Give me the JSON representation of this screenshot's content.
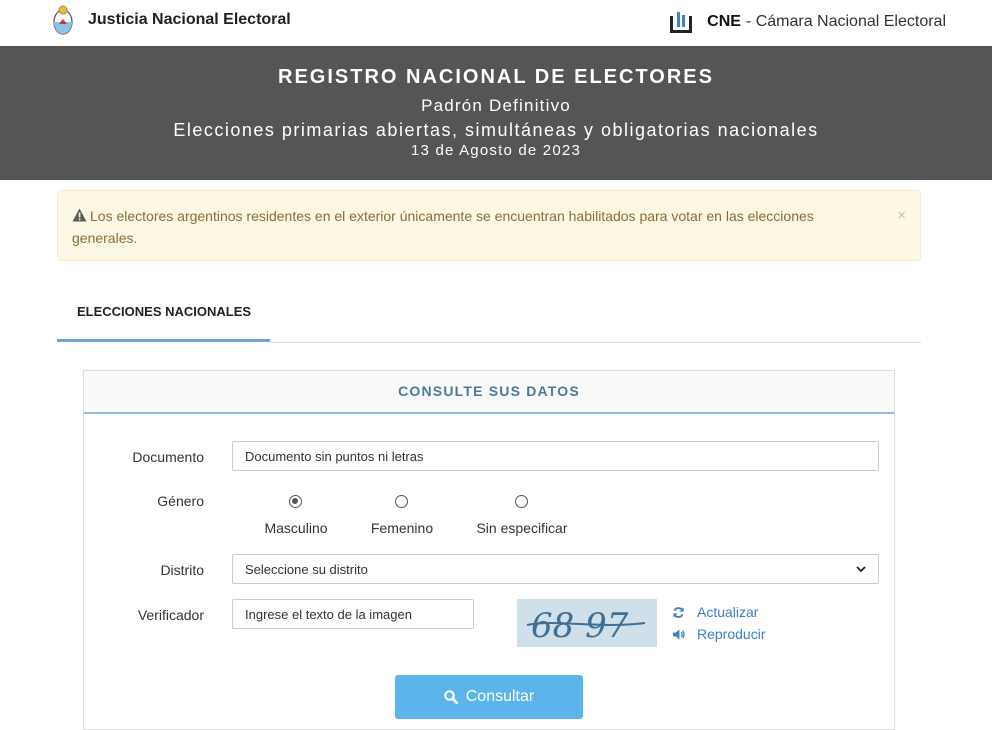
{
  "header": {
    "left_title": "Justicia Nacional Electoral",
    "right_abbr": "CNE",
    "right_title": "- Cámara Nacional Electoral"
  },
  "banner": {
    "line1": "REGISTRO NACIONAL DE ELECTORES",
    "line2": "Padrón Definitivo",
    "line3": "Elecciones primarias abiertas, simultáneas y obligatorias nacionales",
    "line4": "13 de Agosto de 2023"
  },
  "alert": {
    "text": "Los electores argentinos residentes en el exterior únicamente se encuentran habilitados para votar en las elecciones generales.",
    "close": "×"
  },
  "tabs": [
    {
      "label": "ELECCIONES NACIONALES",
      "active": true
    }
  ],
  "form": {
    "heading": "CONSULTE SUS DATOS",
    "documento_label": "Documento",
    "documento_placeholder": "Documento sin puntos ni letras",
    "genero_label": "Género",
    "genero_options": [
      {
        "label": "Masculino",
        "checked": true
      },
      {
        "label": "Femenino",
        "checked": false
      },
      {
        "label": "Sin especificar",
        "checked": false
      }
    ],
    "distrito_label": "Distrito",
    "distrito_value": "Seleccione su distrito",
    "verificador_label": "Verificador",
    "verificador_placeholder": "Ingrese el texto de la imagen",
    "captcha_text": "68 97",
    "actualizar": "Actualizar",
    "reproducir": "Reproducir",
    "submit": "Consultar"
  },
  "colors": {
    "banner": "#555555",
    "alert_bg": "#fcf8e3",
    "alert_text": "#8a6d3b",
    "accent": "#6aa6d8",
    "link": "#3a82c4",
    "button": "#5bb4ea"
  }
}
